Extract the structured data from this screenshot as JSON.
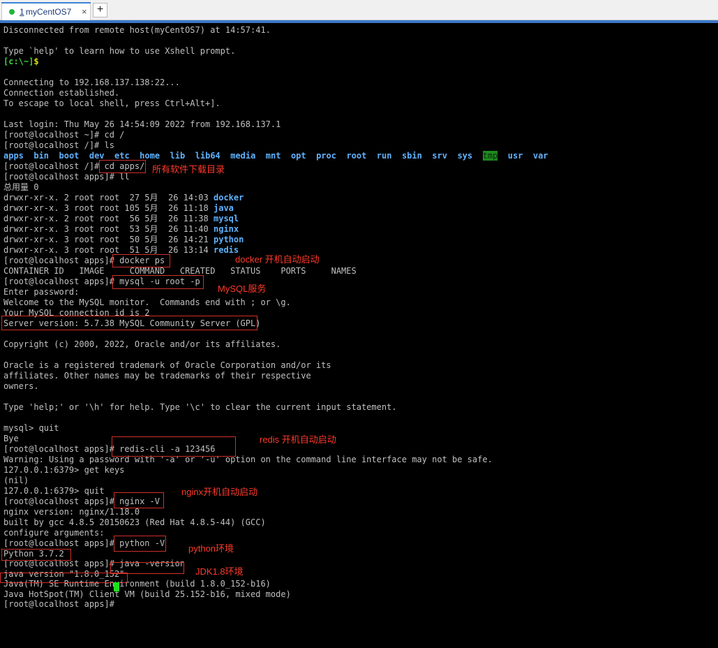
{
  "tabs": [
    {
      "index": "1",
      "label": "myCentOS7",
      "close_symbol": "×"
    }
  ],
  "add_tab_symbol": "+",
  "terminal": {
    "lines": [
      {
        "kind": "plain",
        "text": "Disconnected from remote host(myCentOS7) at 14:57:41."
      },
      {
        "kind": "plain",
        "text": ""
      },
      {
        "kind": "plain",
        "text": "Type `help' to learn how to use Xshell prompt."
      },
      {
        "kind": "local_prompt",
        "bracket": "[c:\\~]",
        "sign": "$"
      },
      {
        "kind": "plain",
        "text": ""
      },
      {
        "kind": "plain",
        "text": "Connecting to 192.168.137.138:22..."
      },
      {
        "kind": "plain",
        "text": "Connection established."
      },
      {
        "kind": "plain",
        "text": "To escape to local shell, press Ctrl+Alt+]."
      },
      {
        "kind": "plain",
        "text": ""
      },
      {
        "kind": "plain",
        "text": "Last login: Thu May 26 14:54:09 2022 from 192.168.137.1"
      },
      {
        "kind": "plain",
        "text": "[root@localhost ~]# cd /"
      },
      {
        "kind": "plain",
        "text": "[root@localhost /]# ls"
      },
      {
        "kind": "ls",
        "items": [
          {
            "t": "apps",
            "s": "dir"
          },
          {
            "t": "  ",
            "s": ""
          },
          {
            "t": "bin",
            "s": "dir"
          },
          {
            "t": "  ",
            "s": ""
          },
          {
            "t": "boot",
            "s": "dir"
          },
          {
            "t": "  ",
            "s": ""
          },
          {
            "t": "dev",
            "s": "dir"
          },
          {
            "t": "  ",
            "s": ""
          },
          {
            "t": "etc",
            "s": "dir"
          },
          {
            "t": "  ",
            "s": ""
          },
          {
            "t": "home",
            "s": "dir"
          },
          {
            "t": "  ",
            "s": ""
          },
          {
            "t": "lib",
            "s": "dir"
          },
          {
            "t": "  ",
            "s": ""
          },
          {
            "t": "lib64",
            "s": "dir"
          },
          {
            "t": "  ",
            "s": ""
          },
          {
            "t": "media",
            "s": "dir"
          },
          {
            "t": "  ",
            "s": ""
          },
          {
            "t": "mnt",
            "s": "dir"
          },
          {
            "t": "  ",
            "s": ""
          },
          {
            "t": "opt",
            "s": "dir"
          },
          {
            "t": "  ",
            "s": ""
          },
          {
            "t": "proc",
            "s": "dir"
          },
          {
            "t": "  ",
            "s": ""
          },
          {
            "t": "root",
            "s": "dir"
          },
          {
            "t": "  ",
            "s": ""
          },
          {
            "t": "run",
            "s": "dir"
          },
          {
            "t": "  ",
            "s": ""
          },
          {
            "t": "sbin",
            "s": "dir"
          },
          {
            "t": "  ",
            "s": ""
          },
          {
            "t": "srv",
            "s": "dir"
          },
          {
            "t": "  ",
            "s": ""
          },
          {
            "t": "sys",
            "s": "dir"
          },
          {
            "t": "  ",
            "s": ""
          },
          {
            "t": "tmp",
            "s": "tmp"
          },
          {
            "t": "  ",
            "s": ""
          },
          {
            "t": "usr",
            "s": "dir"
          },
          {
            "t": "  ",
            "s": ""
          },
          {
            "t": "var",
            "s": "dir"
          }
        ]
      },
      {
        "kind": "plain",
        "text": "[root@localhost /]# cd apps/"
      },
      {
        "kind": "plain",
        "text": "[root@localhost apps]# ll"
      },
      {
        "kind": "plain",
        "text": "总用量 0"
      },
      {
        "kind": "ll",
        "prefix": "drwxr-xr-x. 2 root root  27 5月  26 14:03 ",
        "name": "docker"
      },
      {
        "kind": "ll",
        "prefix": "drwxr-xr-x. 3 root root 105 5月  26 11:18 ",
        "name": "java"
      },
      {
        "kind": "ll",
        "prefix": "drwxr-xr-x. 2 root root  56 5月  26 11:38 ",
        "name": "mysql"
      },
      {
        "kind": "ll",
        "prefix": "drwxr-xr-x. 3 root root  53 5月  26 11:40 ",
        "name": "nginx"
      },
      {
        "kind": "ll",
        "prefix": "drwxr-xr-x. 3 root root  50 5月  26 14:21 ",
        "name": "python"
      },
      {
        "kind": "ll",
        "prefix": "drwxr-xr-x. 3 root root  51 5月  26 13:14 ",
        "name": "redis"
      },
      {
        "kind": "plain",
        "text": "[root@localhost apps]# docker ps"
      },
      {
        "kind": "plain",
        "text": "CONTAINER ID   IMAGE     COMMAND   CREATED   STATUS    PORTS     NAMES"
      },
      {
        "kind": "plain",
        "text": "[root@localhost apps]# mysql -u root -p"
      },
      {
        "kind": "plain",
        "text": "Enter password:"
      },
      {
        "kind": "plain",
        "text": "Welcome to the MySQL monitor.  Commands end with ; or \\g."
      },
      {
        "kind": "plain",
        "text": "Your MySQL connection id is 2"
      },
      {
        "kind": "plain",
        "text": "Server version: 5.7.38 MySQL Community Server (GPL)"
      },
      {
        "kind": "plain",
        "text": ""
      },
      {
        "kind": "plain",
        "text": "Copyright (c) 2000, 2022, Oracle and/or its affiliates."
      },
      {
        "kind": "plain",
        "text": ""
      },
      {
        "kind": "plain",
        "text": "Oracle is a registered trademark of Oracle Corporation and/or its"
      },
      {
        "kind": "plain",
        "text": "affiliates. Other names may be trademarks of their respective"
      },
      {
        "kind": "plain",
        "text": "owners."
      },
      {
        "kind": "plain",
        "text": ""
      },
      {
        "kind": "plain",
        "text": "Type 'help;' or '\\h' for help. Type '\\c' to clear the current input statement."
      },
      {
        "kind": "plain",
        "text": ""
      },
      {
        "kind": "plain",
        "text": "mysql> quit"
      },
      {
        "kind": "plain",
        "text": "Bye"
      },
      {
        "kind": "plain",
        "text": "[root@localhost apps]# redis-cli -a 123456"
      },
      {
        "kind": "plain",
        "text": "Warning: Using a password with '-a' or '-u' option on the command line interface may not be safe."
      },
      {
        "kind": "plain",
        "text": "127.0.0.1:6379> get keys"
      },
      {
        "kind": "plain",
        "text": "(nil)"
      },
      {
        "kind": "plain",
        "text": "127.0.0.1:6379> quit"
      },
      {
        "kind": "plain",
        "text": "[root@localhost apps]# nginx -V"
      },
      {
        "kind": "plain",
        "text": "nginx version: nginx/1.18.0"
      },
      {
        "kind": "plain",
        "text": "built by gcc 4.8.5 20150623 (Red Hat 4.8.5-44) (GCC)"
      },
      {
        "kind": "plain",
        "text": "configure arguments:"
      },
      {
        "kind": "plain",
        "text": "[root@localhost apps]# python -V"
      },
      {
        "kind": "plain",
        "text": "Python 3.7.2"
      },
      {
        "kind": "plain",
        "text": "[root@localhost apps]# java -version"
      },
      {
        "kind": "plain",
        "text": "java version \"1.8.0_152\""
      },
      {
        "kind": "plain",
        "text": "Java(TM) SE Runtime Environment (build 1.8.0_152-b16)"
      },
      {
        "kind": "plain",
        "text": "Java HotSpot(TM) Client VM (build 25.152-b16, mixed mode)"
      },
      {
        "kind": "plain",
        "text": "[root@localhost apps]# "
      }
    ]
  },
  "annotations": {
    "apps_dir": "所有软件下载目录",
    "docker": "docker 开机自动启动",
    "mysql": "MySQL服务",
    "redis": "redis 开机自动启动",
    "nginx": "nginx开机自动启动",
    "python": "python环境",
    "jdk": "JDK1.8环境"
  },
  "colors": {
    "directory": "#5fb2ff",
    "annotation": "#ff3a2a",
    "cursor": "#1ee01e",
    "tab_accent": "#3b82d6"
  }
}
